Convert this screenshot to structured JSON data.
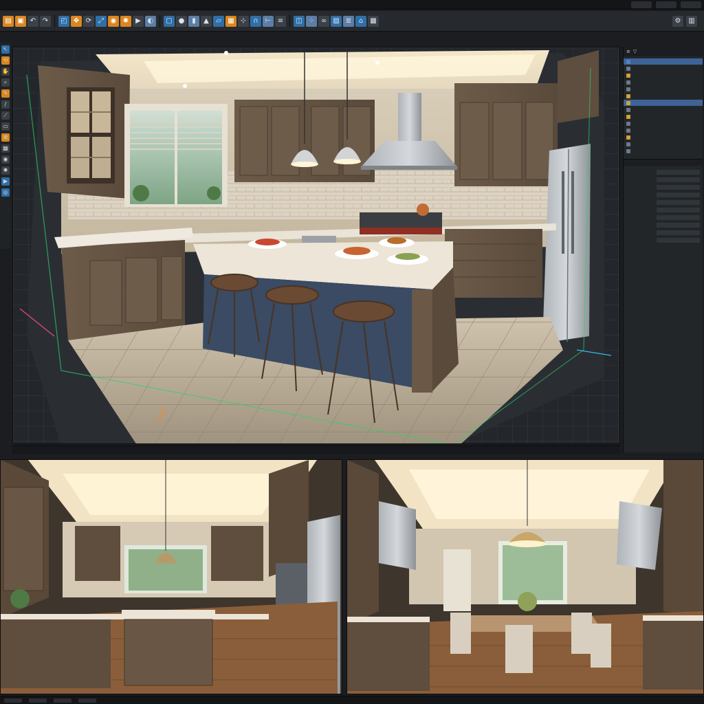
{
  "icons": {
    "toolbar": [
      "folder-icon",
      "save-icon",
      "undo-icon",
      "redo-icon",
      "select-icon",
      "move-icon",
      "rotate-icon",
      "scale-icon",
      "camera-icon",
      "light-icon",
      "render-icon",
      "material-icon",
      "cube-icon",
      "sphere-icon",
      "cylinder-icon",
      "cone-icon",
      "plane-icon",
      "grid-icon",
      "snap-icon",
      "magnet-icon",
      "measure-icon",
      "align-icon",
      "mirror-icon",
      "array-icon",
      "link-icon",
      "image-icon",
      "layers-icon",
      "home-icon",
      "scene-icon",
      "settings-icon"
    ],
    "tools": [
      "cursor-icon",
      "orbit-icon",
      "pan-icon",
      "zoom-icon",
      "pen-icon",
      "brush-icon",
      "knife-icon",
      "eraser-icon",
      "layers-icon",
      "texture-icon",
      "camera-icon",
      "light-icon",
      "render-icon",
      "view-icon"
    ]
  },
  "colors": {
    "accent": "#d9861f",
    "selection": "#3f6396",
    "panel": "#232629",
    "viewport": "#23272c"
  }
}
